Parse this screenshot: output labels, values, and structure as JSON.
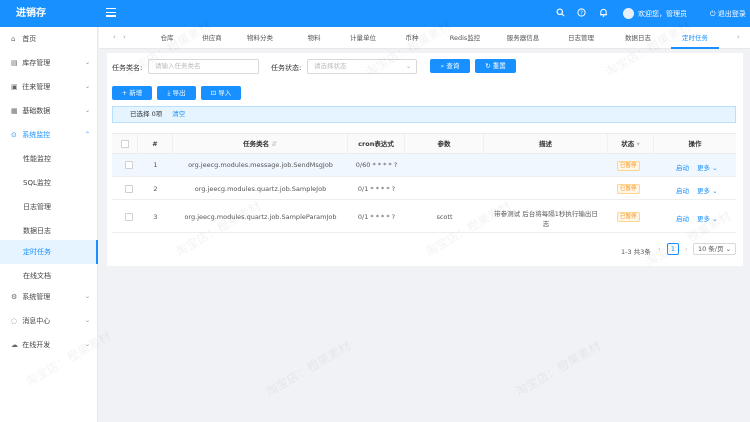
{
  "header": {
    "app_title": "进销存",
    "welcome_text": "欢迎您，管理员",
    "logout_label": "退出登录"
  },
  "sidebar": {
    "items": [
      {
        "label": "首页",
        "icon": "home-icon"
      },
      {
        "label": "库存管理",
        "icon": "inventory-icon"
      },
      {
        "label": "往来管理",
        "icon": "transactions-icon"
      },
      {
        "label": "基础数据",
        "icon": "data-icon"
      },
      {
        "label": "系统监控",
        "icon": "monitor-icon"
      },
      {
        "label": "性能监控"
      },
      {
        "label": "SQL监控"
      },
      {
        "label": "日志管理"
      },
      {
        "label": "数据日志"
      },
      {
        "label": "定时任务"
      },
      {
        "label": "在线文档"
      },
      {
        "label": "系统管理",
        "icon": "settings-icon"
      },
      {
        "label": "消息中心",
        "icon": "message-icon"
      },
      {
        "label": "在线开发",
        "icon": "cloud-icon"
      }
    ]
  },
  "tabs": [
    "仓库",
    "供应商",
    "物料分类",
    "物料",
    "计量单位",
    "币种",
    "Redis监控",
    "服务器信息",
    "日志管理",
    "数据日志",
    "定时任务"
  ],
  "search": {
    "job_name_label": "任务类名:",
    "job_name_placeholder": "请输入任务类名",
    "status_label": "任务状态:",
    "status_placeholder": "请选择状态",
    "query_label": "查询",
    "reset_label": "重置"
  },
  "toolbar": {
    "add_label": "新增",
    "export_label": "导出",
    "import_label": "导入"
  },
  "selection": {
    "text": "已选择 0项",
    "clear_label": "清空"
  },
  "table": {
    "columns": [
      "#",
      "任务类名",
      "cron表达式",
      "参数",
      "描述",
      "状态",
      "操作"
    ],
    "rows": [
      {
        "index": "1",
        "class_name": "org.jeecg.modules.message.job.SendMsgJob",
        "cron": "0/60 * * * * ?",
        "params": "",
        "description": "",
        "status": "已暂停",
        "action": "启动",
        "more": "更多"
      },
      {
        "index": "2",
        "class_name": "org.jeecg.modules.quartz.job.SampleJob",
        "cron": "0/1 * * * * ?",
        "params": "",
        "description": "",
        "status": "已暂停",
        "action": "启动",
        "more": "更多"
      },
      {
        "index": "3",
        "class_name": "org.jeecg.modules.quartz.job.SampleParamJob",
        "cron": "0/1 * * * * ?",
        "params": "scott",
        "description_line1": "带参测试 后台将每隔1秒执行输出日",
        "description_line2": "志",
        "status": "已暂停",
        "action": "启动",
        "more": "更多"
      }
    ]
  },
  "pagination": {
    "total_text": "1-3 共3条",
    "current_page": "1",
    "page_size": "10 条/页"
  },
  "watermark": "淘宝店：橙果素材",
  "colors": {
    "primary": "#1890ff",
    "warning": "#fa8c16"
  }
}
